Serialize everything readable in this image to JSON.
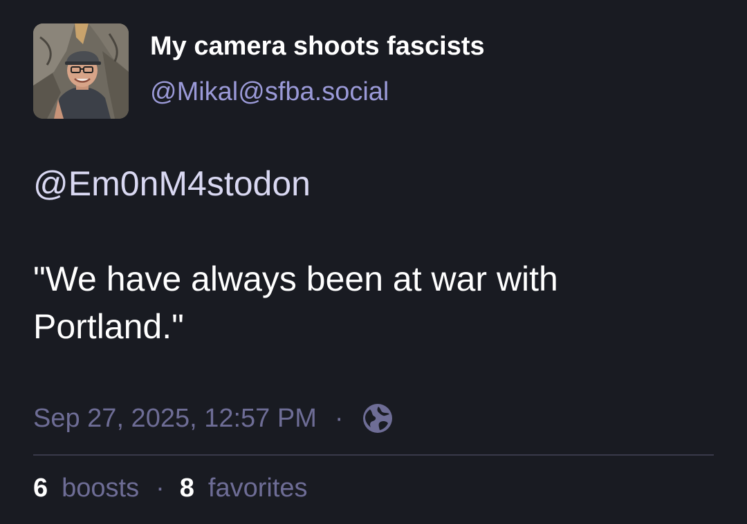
{
  "author": {
    "display_name": "My camera shoots fascists",
    "handle": "@Mikal@sfba.social",
    "avatar_icon": "avatar-photo-icon"
  },
  "content": {
    "mention": "@Em0nM4stodon",
    "text": "\"We have always been at war with Portland.\""
  },
  "meta": {
    "timestamp": "Sep 27, 2025, 12:57 PM",
    "separator": "·",
    "visibility_icon": "globe-icon"
  },
  "stats": {
    "boosts_count": "6",
    "boosts_label": "boosts",
    "separator": "·",
    "favorites_count": "8",
    "favorites_label": "favorites"
  },
  "colors": {
    "background": "#191b22",
    "handle": "#9b9ad8",
    "muted": "#6e6d96",
    "divider": "#393a4a",
    "text": "#ffffff"
  }
}
